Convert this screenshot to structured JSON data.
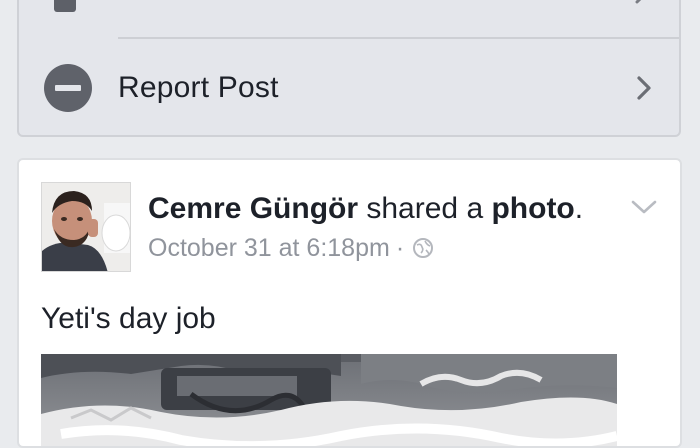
{
  "menu": {
    "report_post_label": "Report Post"
  },
  "post": {
    "author_name": "Cemre Güngör",
    "action_text": "shared a",
    "object_text": "photo",
    "period": ".",
    "timestamp": "October 31 at 6:18pm",
    "meta_separator": "·",
    "privacy_icon": "globe-icon",
    "body_text": "Yeti's day job"
  },
  "colors": {
    "background": "#e9ebee",
    "menu_card": "#e4e6eb",
    "icon_gray": "#5f626a",
    "meta_gray": "#90949c",
    "text": "#1d2129"
  }
}
